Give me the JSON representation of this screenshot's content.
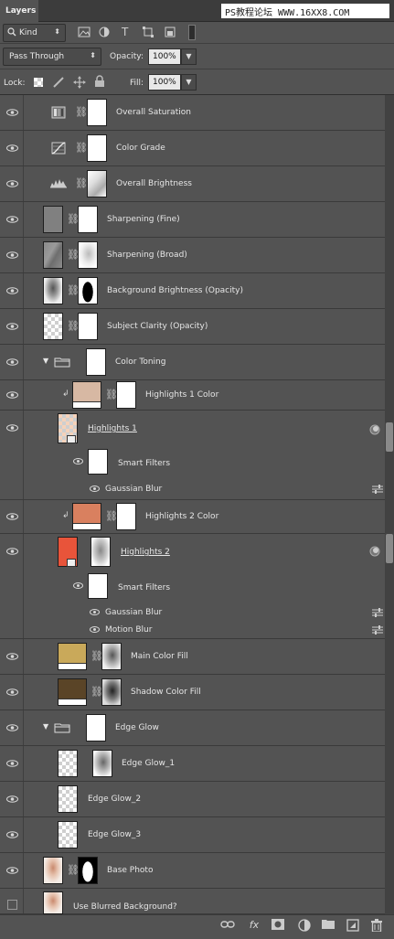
{
  "panel": {
    "tab_title": "Layers",
    "watermark": "PS教程论坛 WWW.16XX8.COM"
  },
  "filter": {
    "kind_label": "Kind",
    "icons": [
      "image-filter-icon",
      "adjustment-filter-icon",
      "type-filter-icon",
      "shape-filter-icon",
      "smart-object-filter-icon"
    ]
  },
  "blend": {
    "mode": "Pass Through",
    "opacity_label": "Opacity:",
    "opacity_value": "100%"
  },
  "lock": {
    "label": "Lock:",
    "fill_label": "Fill:",
    "fill_value": "100%"
  },
  "layers": [
    {
      "name": "Overall Saturation",
      "type": "adjustment",
      "icon": "hue-saturation-icon"
    },
    {
      "name": "Color Grade",
      "type": "adjustment",
      "icon": "curves-icon"
    },
    {
      "name": "Overall Brightness",
      "type": "adjustment",
      "icon": "levels-icon"
    },
    {
      "name": "Sharpening (Fine)"
    },
    {
      "name": "Sharpening (Broad)"
    },
    {
      "name": "Background Brightness (Opacity)"
    },
    {
      "name": "Subject Clarity (Opacity)"
    },
    {
      "name": "Color Toning",
      "type": "group"
    },
    {
      "name": "Highlights 1 Color",
      "type": "fill",
      "color": "#d7b8a3"
    },
    {
      "name": "Highlights 1",
      "type": "smart-object"
    },
    {
      "name": "Smart Filters"
    },
    {
      "name": "Gaussian Blur"
    },
    {
      "name": "Highlights 2 Color",
      "type": "fill",
      "color": "#d9805f"
    },
    {
      "name": "Highlights 2",
      "type": "smart-object"
    },
    {
      "name": "Smart Filters"
    },
    {
      "name": "Gaussian Blur"
    },
    {
      "name": "Motion Blur"
    },
    {
      "name": "Main Color Fill",
      "type": "fill",
      "color": "#c9a95a"
    },
    {
      "name": "Shadow Color Fill",
      "type": "fill",
      "color": "#5a4427"
    },
    {
      "name": "Edge Glow",
      "type": "group"
    },
    {
      "name": "Edge Glow_1"
    },
    {
      "name": "Edge Glow_2"
    },
    {
      "name": "Edge Glow_3"
    },
    {
      "name": "Base Photo"
    },
    {
      "name": "Use Blurred Background?"
    }
  ],
  "footer": {
    "buttons": [
      "link-layers-icon",
      "fx-icon",
      "add-mask-icon",
      "new-adjustment-icon",
      "new-group-icon",
      "new-layer-icon",
      "trash-icon"
    ],
    "fx_label": "fx"
  },
  "colors": {
    "panel_bg": "#535353",
    "row_divider": "#3a3a3a",
    "text": "#e6e6e6"
  }
}
